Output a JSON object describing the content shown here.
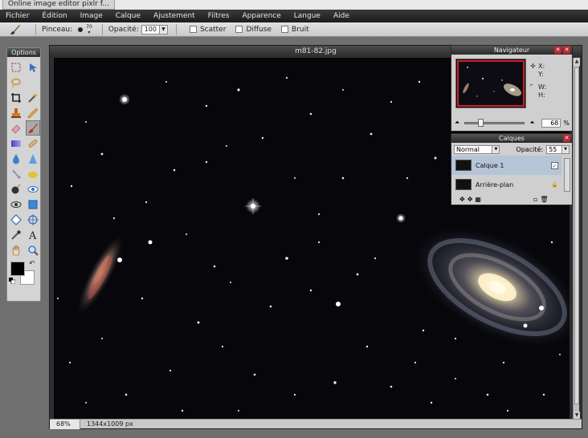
{
  "browser_tab": {
    "title": "Online image editor pixlr f..."
  },
  "menu": [
    "Fichier",
    "Édition",
    "Image",
    "Calque",
    "Ajustement",
    "Filtres",
    "Apparence",
    "Langue",
    "Aide"
  ],
  "options_bar": {
    "brush_label": "Pinceau:",
    "brush_size": "70",
    "opacity_label": "Opacité:",
    "opacity_value": "100",
    "checkboxes": [
      "Scatter",
      "Diffuse",
      "Bruit"
    ]
  },
  "tools_panel": {
    "title": "Options"
  },
  "canvas": {
    "title": "m81-82.jpg",
    "zoom": "68%",
    "dimensions": "1344x1009 px"
  },
  "navigator": {
    "title": "Navigateur",
    "x_label": "X:",
    "y_label": "Y:",
    "w_label": "W:",
    "h_label": "H:",
    "zoom_value": "68",
    "zoom_unit": "%"
  },
  "layers": {
    "title": "Calques",
    "blend_mode": "Normal",
    "opacity_label": "Opacité:",
    "opacity_value": "55",
    "items": [
      {
        "name": "Calque 1",
        "visible": true
      },
      {
        "name": "Arrière-plan",
        "locked": true
      }
    ]
  },
  "colors": {
    "foreground": "#000000",
    "background": "#ffffff",
    "accent": "#c0272d"
  }
}
